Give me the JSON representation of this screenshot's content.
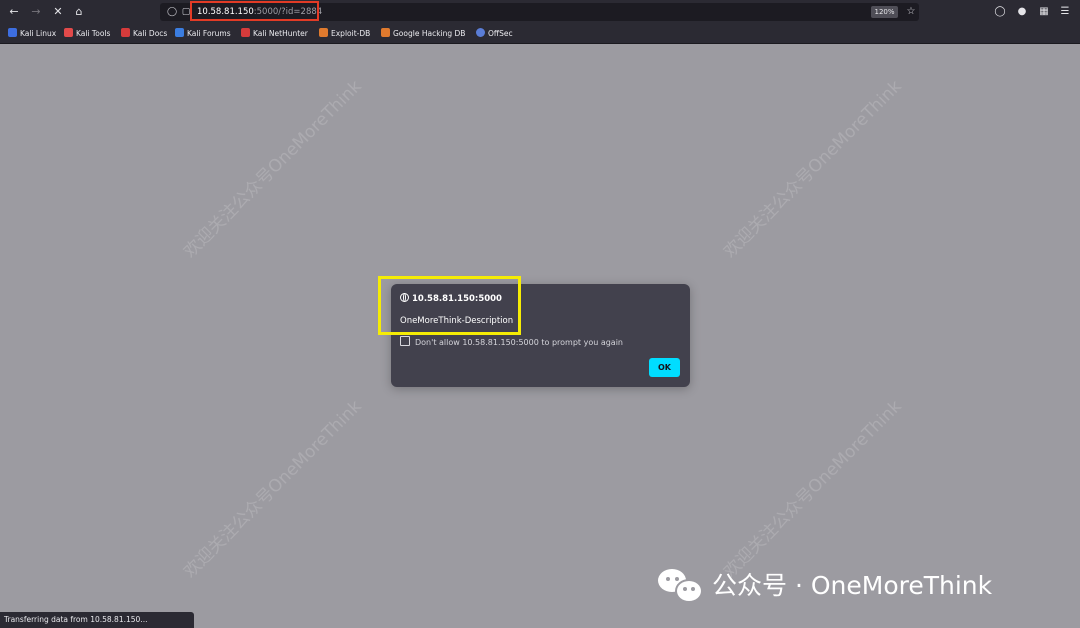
{
  "browser": {
    "url_host": "10.58.81.150",
    "url_rest": ":5000/?id=2884",
    "zoom": "120%",
    "bookmarks": [
      {
        "label": "Kali Linux",
        "color": "#3d6ee0"
      },
      {
        "label": "Kali Tools",
        "color": "#e24a4a"
      },
      {
        "label": "Kali Docs",
        "color": "#d63b3b"
      },
      {
        "label": "Kali Forums",
        "color": "#3b7de0"
      },
      {
        "label": "Kali NetHunter",
        "color": "#d63b3b"
      },
      {
        "label": "Exploit-DB",
        "color": "#e07a2e"
      },
      {
        "label": "Google Hacking DB",
        "color": "#e07a2e"
      },
      {
        "label": "OffSec",
        "color": "#5a7dd6"
      }
    ]
  },
  "dialog": {
    "origin": "10.58.81.150:5000",
    "message": "OneMoreThink-Description",
    "checkbox_label": "Don't allow 10.58.81.150:5000 to prompt you again",
    "ok_label": "OK"
  },
  "status": {
    "text": "Transferring data from 10.58.81.150..."
  },
  "watermark": {
    "text": "欢迎关注公众号OneMoreThink"
  },
  "branding": {
    "text": "公众号 · OneMoreThink"
  },
  "colors": {
    "url_highlight": "#e23b26",
    "dialog_highlight": "#f5ec05",
    "ok_button": "#00ddff"
  }
}
